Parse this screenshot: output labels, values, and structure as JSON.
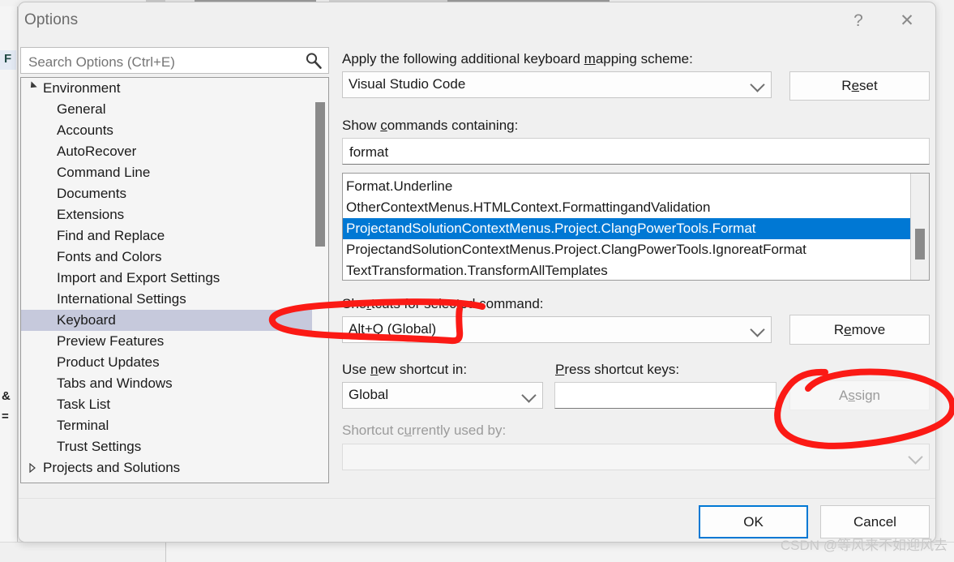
{
  "window": {
    "title": "Options",
    "help_icon": "?",
    "close_icon": "✕"
  },
  "search": {
    "placeholder": "Search Options (Ctrl+E)",
    "value": "",
    "icon": "search-icon"
  },
  "tree": {
    "items": [
      {
        "label": "Environment",
        "level": 0,
        "expander": "open",
        "selected": false
      },
      {
        "label": "General",
        "level": 1,
        "expander": "none",
        "selected": false
      },
      {
        "label": "Accounts",
        "level": 1,
        "expander": "none",
        "selected": false
      },
      {
        "label": "AutoRecover",
        "level": 1,
        "expander": "none",
        "selected": false
      },
      {
        "label": "Command Line",
        "level": 1,
        "expander": "none",
        "selected": false
      },
      {
        "label": "Documents",
        "level": 1,
        "expander": "none",
        "selected": false
      },
      {
        "label": "Extensions",
        "level": 1,
        "expander": "none",
        "selected": false
      },
      {
        "label": "Find and Replace",
        "level": 1,
        "expander": "none",
        "selected": false
      },
      {
        "label": "Fonts and Colors",
        "level": 1,
        "expander": "none",
        "selected": false
      },
      {
        "label": "Import and Export Settings",
        "level": 1,
        "expander": "none",
        "selected": false
      },
      {
        "label": "International Settings",
        "level": 1,
        "expander": "none",
        "selected": false
      },
      {
        "label": "Keyboard",
        "level": 1,
        "expander": "none",
        "selected": true
      },
      {
        "label": "Preview Features",
        "level": 1,
        "expander": "none",
        "selected": false
      },
      {
        "label": "Product Updates",
        "level": 1,
        "expander": "none",
        "selected": false
      },
      {
        "label": "Tabs and Windows",
        "level": 1,
        "expander": "none",
        "selected": false
      },
      {
        "label": "Task List",
        "level": 1,
        "expander": "none",
        "selected": false
      },
      {
        "label": "Terminal",
        "level": 1,
        "expander": "none",
        "selected": false
      },
      {
        "label": "Trust Settings",
        "level": 1,
        "expander": "none",
        "selected": false
      },
      {
        "label": "Projects and Solutions",
        "level": 0,
        "expander": "closed",
        "selected": false
      }
    ]
  },
  "pane": {
    "mapping_scheme_label_pre": "Apply the following additional keyboard ",
    "mapping_scheme_label_acc": "m",
    "mapping_scheme_label_post": "apping scheme:",
    "mapping_scheme_value": "Visual Studio Code",
    "reset_label_pre": "R",
    "reset_label_acc": "e",
    "reset_label_post": "set",
    "show_commands_label_pre": "Show ",
    "show_commands_label_acc": "c",
    "show_commands_label_post": "ommands containing:",
    "show_commands_value": "format",
    "show_commands_placeholder": "",
    "commands": [
      {
        "text": "Format.Underline",
        "selected": false
      },
      {
        "text": "OtherContextMenus.HTMLContext.FormattingandValidation",
        "selected": false
      },
      {
        "text": "ProjectandSolutionContextMenus.Project.ClangPowerTools.Format",
        "selected": true
      },
      {
        "text": "ProjectandSolutionContextMenus.Project.ClangPowerTools.IgnoreatFormat",
        "selected": false
      },
      {
        "text": "TextTransformation.TransformAllTemplates",
        "selected": false
      }
    ],
    "shortcuts_label_pre": "Sho",
    "shortcuts_label_acc": "r",
    "shortcuts_label_post": "tcuts for selected command:",
    "shortcuts_value": "Alt+Q (Global)",
    "remove_label_pre": "R",
    "remove_label_acc": "e",
    "remove_label_post": "move",
    "use_new_shortcut_label_pre": "Use ",
    "use_new_shortcut_label_acc": "n",
    "use_new_shortcut_label_post": "ew shortcut in:",
    "use_new_shortcut_value": "Global",
    "press_shortcut_label_pre": "",
    "press_shortcut_label_acc": "P",
    "press_shortcut_label_post": "ress shortcut keys:",
    "press_shortcut_value": "",
    "press_shortcut_placeholder": "",
    "assign_label_pre": "A",
    "assign_label_acc": "s",
    "assign_label_post": "sign",
    "currently_used_label_pre": "Shortcut c",
    "currently_used_label_acc": "u",
    "currently_used_label_post": "rrently used by:",
    "currently_used_value": ""
  },
  "footer": {
    "ok_label": "OK",
    "cancel_label": "Cancel"
  },
  "watermark": "CSDN @等风来不如迎风去",
  "background": {
    "code_fragment_1": "F",
    "code_fragment_2": "&",
    "code_fragment_3": "="
  },
  "colors": {
    "accent": "#0078d4",
    "selection_tree": "#c6c9dc",
    "annotation": "#fb1a15",
    "dialog_bg": "#f0f0f0"
  },
  "annotations": [
    {
      "name": "circle-alt-q",
      "shape": "hand-drawn-ellipse"
    },
    {
      "name": "circle-assign",
      "shape": "hand-drawn-ellipse"
    }
  ]
}
